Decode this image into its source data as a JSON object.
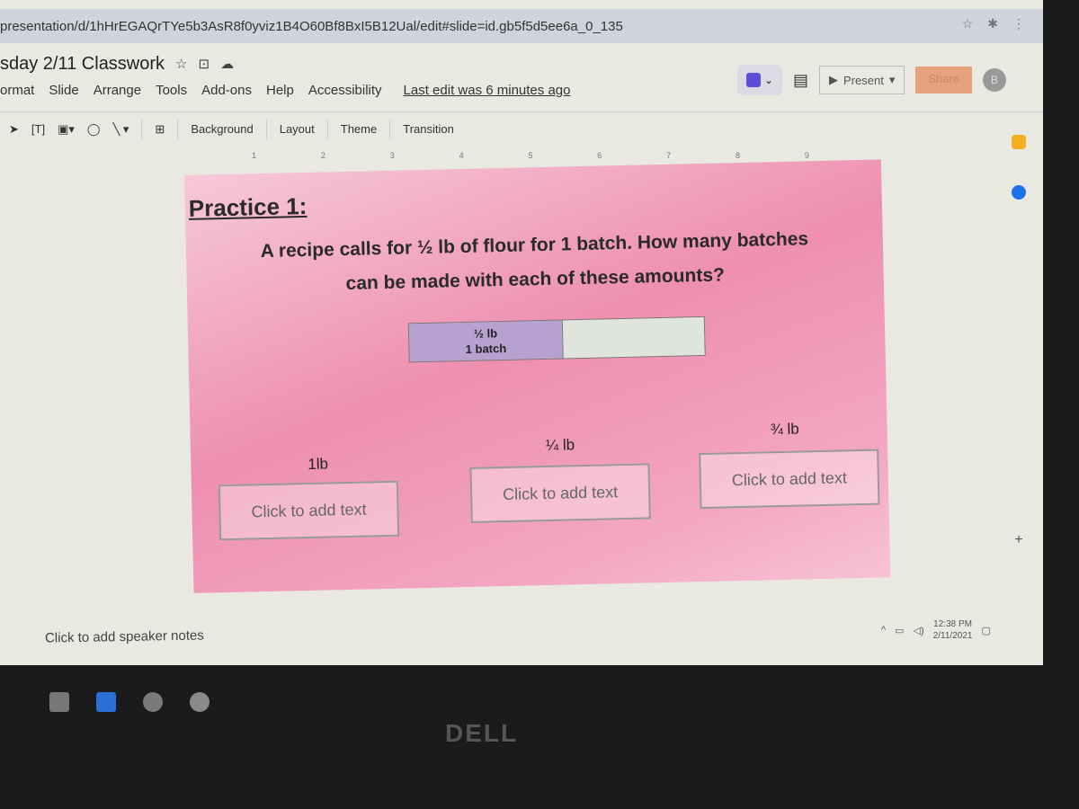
{
  "browser": {
    "url": "presentation/d/1hHrEGAQrTYe5b3AsR8f0yviz1B4O60Bf8BxI5B12Ual/edit#slide=id.gb5f5d5ee6a_0_135"
  },
  "doc": {
    "title": "sday 2/11 Classwork",
    "last_edit": "Last edit was 6 minutes ago"
  },
  "menu": [
    "ormat",
    "Slide",
    "Arrange",
    "Tools",
    "Add-ons",
    "Help",
    "Accessibility"
  ],
  "header": {
    "present": "Present",
    "share": "Share",
    "avatar": "B"
  },
  "toolbar": {
    "background": "Background",
    "layout": "Layout",
    "theme": "Theme",
    "transition": "Transition"
  },
  "ruler": [
    "1",
    "2",
    "3",
    "4",
    "5",
    "6",
    "7",
    "8",
    "9"
  ],
  "slide": {
    "title": "Practice 1:",
    "question_line1": "A recipe calls for ½ lb of flour for 1 batch. How many batches",
    "question_line2": "can be made with each of these amounts?",
    "bar_line1": "½ lb",
    "bar_line2": "1 batch",
    "amounts": [
      "1lb",
      "¼ lb",
      "¾ lb"
    ],
    "placeholder": "Click to add text"
  },
  "notes": "Click to add speaker notes",
  "tray": {
    "time": "12:38 PM",
    "date": "2/11/2021"
  },
  "brand": "DELL"
}
